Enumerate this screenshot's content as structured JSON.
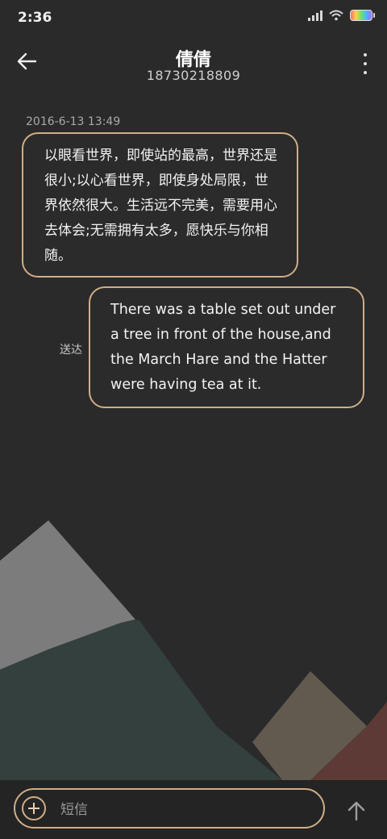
{
  "status_bar": {
    "time": "2:36"
  },
  "header": {
    "contact_name": "倩倩",
    "phone_number": "18730218809"
  },
  "conversation": {
    "timestamp": "2016-6-13 13:49",
    "messages": [
      {
        "direction": "incoming",
        "text": "以眼看世界，即使站的最高，世界还是很小;以心看世界，即使身处局限，世界依然很大。生活远不完美，需要用心去体会;无需拥有太多，愿快乐与你相随。"
      },
      {
        "direction": "outgoing",
        "text": "There was a table set out under a tree in front of the house,and the March Hare and the Hatter were having tea at it.",
        "status": "送达"
      }
    ]
  },
  "compose": {
    "placeholder": "短信"
  },
  "icons": {
    "back": "arrow-left-icon",
    "more": "more-vertical-icon",
    "add": "plus-circle-icon",
    "send": "arrow-up-icon"
  },
  "colors": {
    "accent": "#cfae86",
    "background": "#2a2a2b"
  }
}
